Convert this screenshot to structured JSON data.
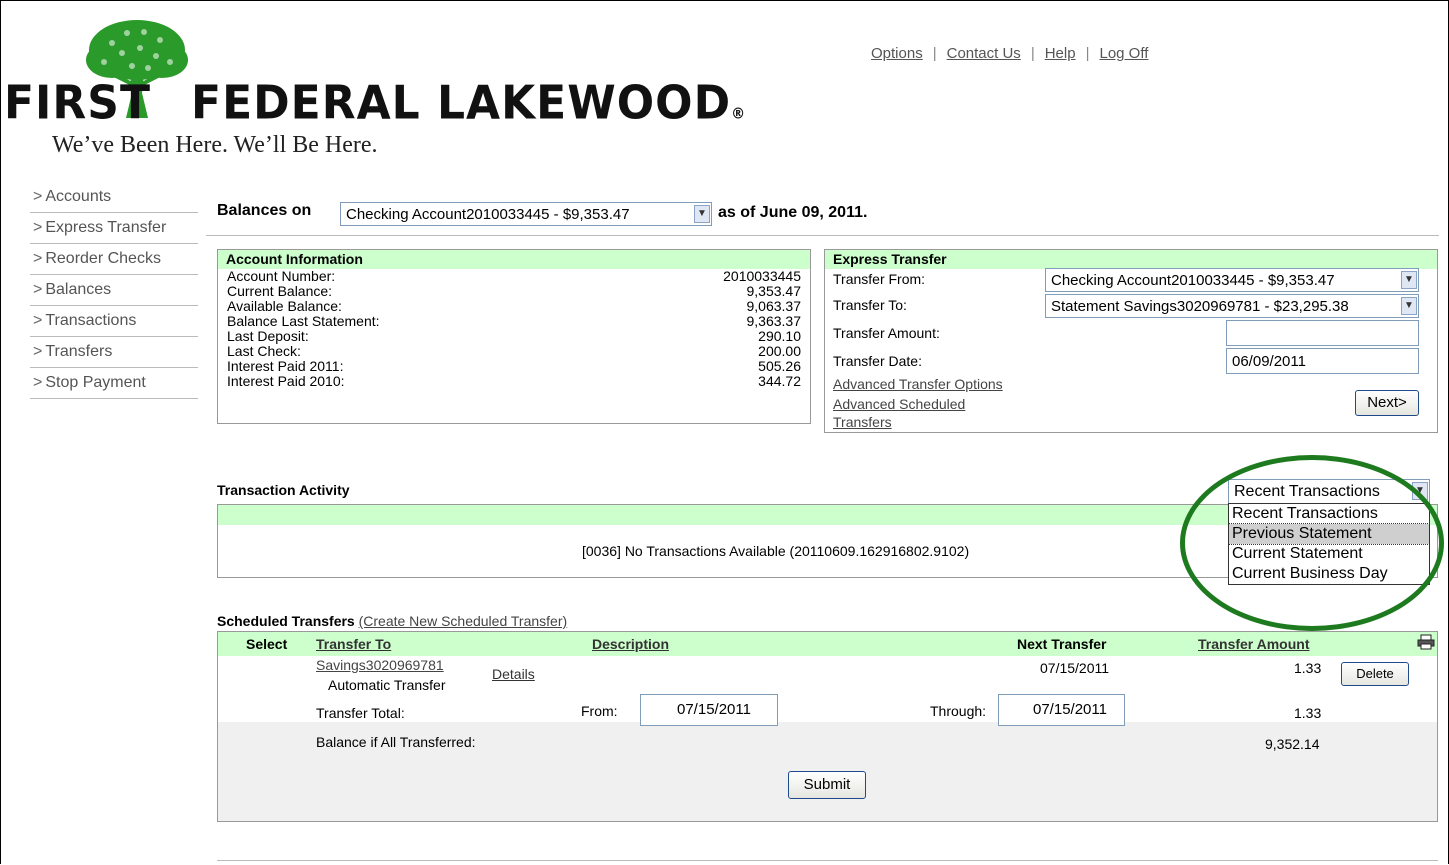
{
  "brand": {
    "name": "FIRST FEDERAL LAKEWOOD",
    "name_first": "FIRST",
    "name_rest": "FEDERAL LAKEWOOD",
    "reg_mark": "®",
    "tagline": "We’ve Been Here.  We’ll Be Here.",
    "color": "#1e8c2a"
  },
  "toplinks": [
    "Options",
    "Contact Us",
    "Help",
    "Log Off"
  ],
  "link_separator": "|",
  "sidebar": {
    "arrow": ">",
    "items": [
      "Accounts",
      "Express Transfer",
      "Reorder Checks",
      "Balances",
      "Transactions",
      "Transfers",
      "Stop Payment"
    ]
  },
  "balances": {
    "prefix": "Balances on",
    "account_selected": "Checking Account2010033445 - $9,353.47",
    "suffix": "as of June 09, 2011."
  },
  "account_info": {
    "title": "Account Information",
    "rows": [
      {
        "label": "Account Number:",
        "value": "2010033445"
      },
      {
        "label": "Current Balance:",
        "value": "9,353.47"
      },
      {
        "label": "Available Balance:",
        "value": "9,063.37"
      },
      {
        "label": "Balance Last Statement:",
        "value": "9,363.37"
      },
      {
        "label": "Last Deposit:",
        "value": "290.10"
      },
      {
        "label": "Last Check:",
        "value": "200.00"
      },
      {
        "label": "Interest Paid 2011:",
        "value": "505.26"
      },
      {
        "label": "Interest Paid 2010:",
        "value": "344.72"
      }
    ]
  },
  "express_transfer": {
    "title": "Express Transfer",
    "from_label": "Transfer From:",
    "from_value": "Checking Account2010033445 - $9,353.47",
    "to_label": "Transfer To:",
    "to_value": "Statement Savings3020969781 - $23,295.38",
    "amount_label": "Transfer Amount:",
    "amount_value": "",
    "date_label": "Transfer Date:",
    "date_value": "06/09/2011",
    "adv_options": "Advanced Transfer Options",
    "adv_sched_1": "Advanced Scheduled",
    "adv_sched_2": "Transfers",
    "next": "Next>"
  },
  "activity": {
    "title": "Transaction Activity",
    "message": "[0036] No Transactions Available (20110609.162916802.9102)",
    "selected": "Recent Transactions",
    "options": [
      "Recent Transactions",
      "Previous Statement",
      "Current Statement",
      "Current Business Day"
    ],
    "highlighted_index": 1,
    "circle_color": "#1e7a1e"
  },
  "scheduled": {
    "title": "Scheduled Transfers",
    "create_link": "(Create New Scheduled Transfer)",
    "headers": {
      "select": "Select",
      "transfer_to": "Transfer To",
      "description": "Description",
      "next_transfer": "Next Transfer",
      "amount": "Transfer Amount"
    },
    "row": {
      "account": "Savings3020969781",
      "type": "Automatic Transfer",
      "details": "Details",
      "next": "07/15/2011",
      "amount": "1.33",
      "delete": "Delete"
    },
    "total_label": "Transfer Total:",
    "from_label": "From:",
    "from_value": "07/15/2011",
    "through_label": "Through:",
    "through_value": "07/15/2011",
    "total_amount": "1.33",
    "balance_label": "Balance if All Transferred:",
    "balance_value": "9,352.14",
    "submit": "Submit"
  }
}
